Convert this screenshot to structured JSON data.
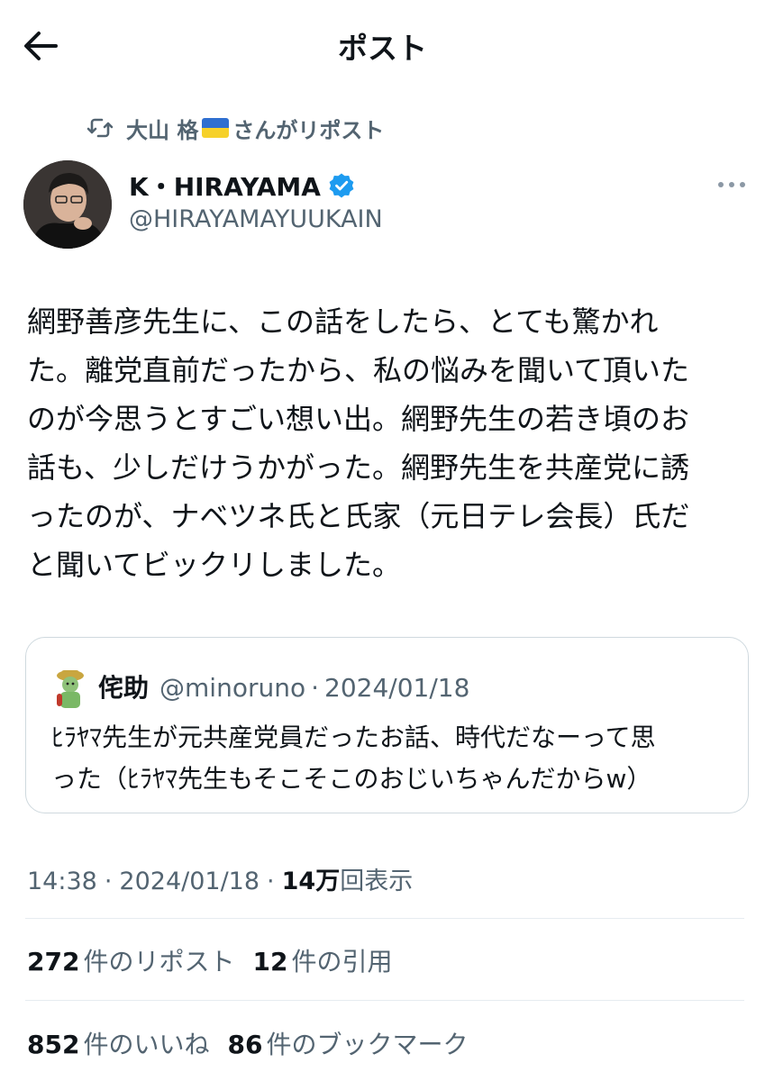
{
  "header": {
    "title": "ポスト"
  },
  "repost": {
    "prefix": "大山 格",
    "suffix": "さんがリポスト"
  },
  "author": {
    "name": "K・HIRAYAMA",
    "handle": "@HIRAYAMAYUUKAIN"
  },
  "tweet": {
    "lines": [
      "網野善彦先生に、この話をしたら、とても驚かれ",
      "た。離党直前だったから、私の悩みを聞いて頂いた",
      "のが今思うとすごい想い出。網野先生の若き頃のお",
      "話も、少しだけうかがった。網野先生を共産党に誘",
      "ったのが、ナベツネ氏と氏家（元日テレ会長）氏だ",
      "と聞いてビックリしました。"
    ]
  },
  "quote": {
    "name": "侘助",
    "handle": "@minoruno",
    "dot": "·",
    "date": "2024/01/18",
    "lines": [
      "ﾋﾗﾔﾏ先生が元共産党員だったお話、時代だなーって思",
      "った（ﾋﾗﾔﾏ先生もそこそこのおじいちゃんだからw）"
    ]
  },
  "meta": {
    "time": "14:38",
    "dot": "·",
    "date": "2024/01/18",
    "views_count": "14万",
    "views_label": "回表示"
  },
  "stats": {
    "reposts_count": "272",
    "reposts_label": "件のリポスト",
    "quotes_count": "12",
    "quotes_label": "件の引用",
    "likes_count": "852",
    "likes_label": "件のいいね",
    "bookmarks_count": "86",
    "bookmarks_label": "件のブックマーク"
  },
  "icons": {
    "back": "arrow-left-icon",
    "repost": "retweet-icon",
    "flag": "ukraine-flag-icon",
    "verified": "verified-badge-icon",
    "more": "more-dots-icon"
  },
  "colors": {
    "text_primary": "#0f1419",
    "text_secondary": "#536471",
    "verified_blue": "#1d9bf0",
    "border": "#cfd9de"
  }
}
